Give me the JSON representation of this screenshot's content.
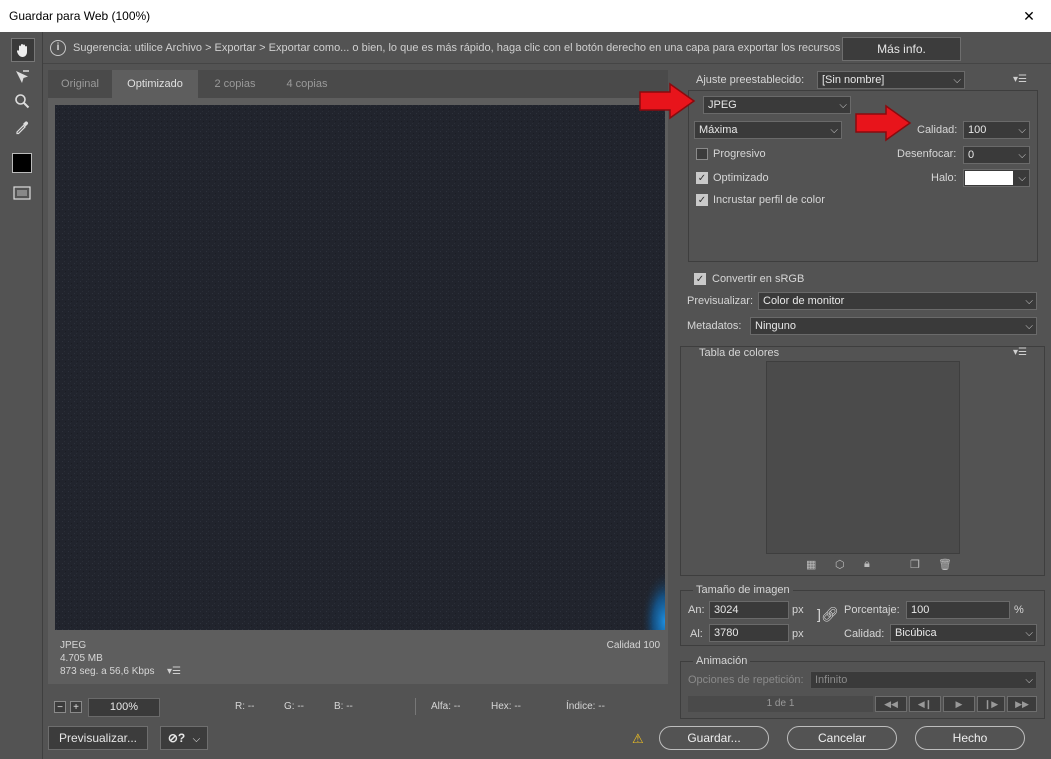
{
  "window": {
    "title": "Guardar para Web (100%)",
    "close_glyph": "✕"
  },
  "hint": {
    "text": "Sugerencia: utilice Archivo > Exportar > Exportar como... o bien, lo que es más rápido, haga clic con el botón derecho en una capa para exportar los recursos",
    "more_info_label": "Más info."
  },
  "tabs": [
    "Original",
    "Optimizado",
    "2 copias",
    "4 copias"
  ],
  "preview_info": {
    "format": "JPEG",
    "size": "4.705 MB",
    "time": "873 seg. a 56,6 Kbps",
    "quality": "Calidad 100"
  },
  "status": {
    "zoom": "100%",
    "r": "R: --",
    "g": "G: --",
    "b": "B: --",
    "alpha": "Alfa: --",
    "hex": "Hex: --",
    "index": "Índice: --"
  },
  "bottom_buttons": {
    "preview": "Previsualizar...",
    "save": "Guardar...",
    "cancel": "Cancelar",
    "done": "Hecho"
  },
  "settings": {
    "preset_label": "Ajuste preestablecido:",
    "preset_value": "[Sin nombre]",
    "format_value": "JPEG",
    "quality_mode": "Máxima",
    "quality_label": "Calidad:",
    "quality_value": "100",
    "progressive_label": "Progresivo",
    "progressive_checked": false,
    "blur_label": "Desenfocar:",
    "blur_value": "0",
    "optimized_label": "Optimizado",
    "optimized_checked": true,
    "matte_label": "Halo:",
    "embed_profile_label": "Incrustar perfil de color",
    "embed_profile_checked": true,
    "convert_srgb_label": "Convertir en sRGB",
    "convert_srgb_checked": true,
    "preview_label": "Previsualizar:",
    "preview_value": "Color de monitor",
    "metadata_label": "Metadatos:",
    "metadata_value": "Ninguno"
  },
  "color_table": {
    "title": "Tabla de colores"
  },
  "image_size": {
    "title": "Tamaño de imagen",
    "width_label": "An:",
    "width_value": "3024",
    "height_label": "Al:",
    "height_value": "3780",
    "unit": "px",
    "percent_label": "Porcentaje:",
    "percent_value": "100",
    "percent_unit": "%",
    "quality_label": "Calidad:",
    "quality_value": "Bicúbica"
  },
  "animation": {
    "title": "Animación",
    "loop_label": "Opciones de repetición:",
    "loop_value": "Infinito",
    "frame_counter": "1 de 1"
  },
  "colors": {
    "arrow": "#e8141b",
    "canvas": "#21242d",
    "accent_blue": "#1e8fe0"
  }
}
